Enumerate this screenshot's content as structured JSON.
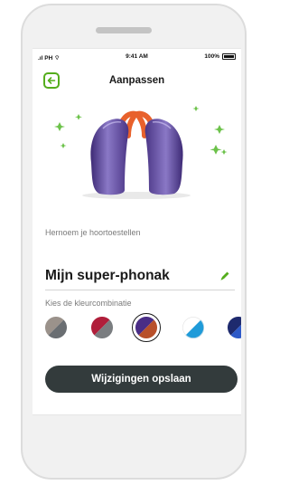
{
  "status_bar": {
    "carrier": "PH",
    "time": "9:41 AM",
    "battery": "100%"
  },
  "header": {
    "title": "Aanpassen"
  },
  "hero": {
    "image": "hearing-aids-purple-orange"
  },
  "rename": {
    "label": "Hernoem je hoortoestellen",
    "value": "Mijn super-phonak"
  },
  "colors": {
    "label": "Kies de kleurcombinatie",
    "selected_index": 2,
    "options": [
      {
        "name": "swatch-grey-brown",
        "a": "#9b928b",
        "b": "#6a6e72"
      },
      {
        "name": "swatch-red-grey",
        "a": "#b01e3a",
        "b": "#7a7d80"
      },
      {
        "name": "swatch-purple-orange",
        "a": "#4a2d86",
        "b": "#b8502a"
      },
      {
        "name": "swatch-white-blue",
        "a": "#ffffff",
        "b": "#1f9bd9"
      },
      {
        "name": "swatch-navy-blue",
        "a": "#1e2a6e",
        "b": "#2d59c8"
      }
    ]
  },
  "actions": {
    "save_label": "Wijzigingen opslaan"
  },
  "accent": "#54ad1c"
}
